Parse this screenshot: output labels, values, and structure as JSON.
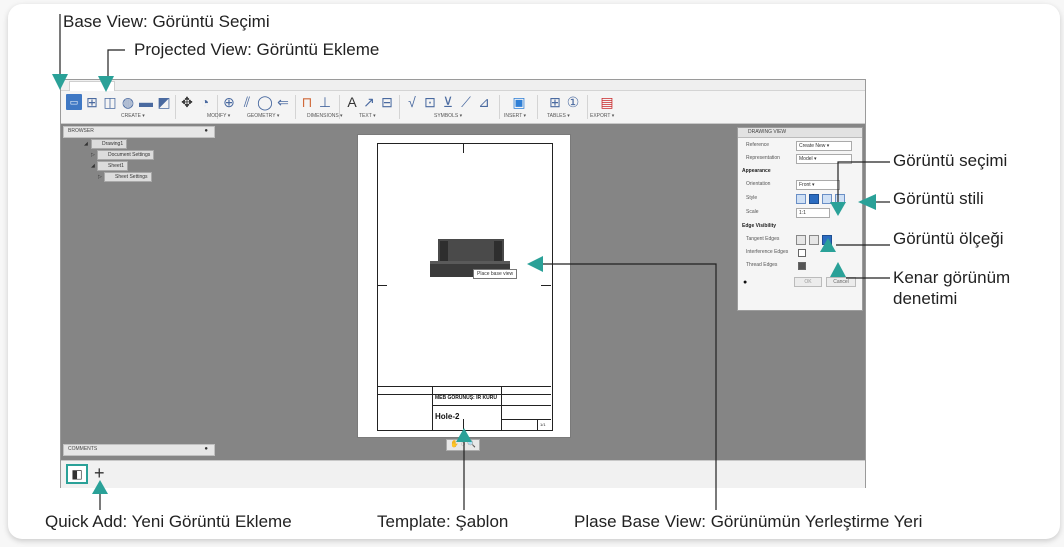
{
  "annotations": {
    "base_view": "Base View: Görüntü Seçimi",
    "projected_view": "Projected View: Görüntü Ekleme",
    "gorunum_secimi": "Görüntü seçimi",
    "gorunum_stili": "Görüntü stili",
    "gorunum_olcegi": "Görüntü ölçeği",
    "kenar_line1": "Kenar görünüm",
    "kenar_line2": "denetimi",
    "quick_add": "Quick Add: Yeni Görüntü Ekleme",
    "template": "Template: Şablon",
    "place_base_view": "Plase Base View: Görünümün Yerleştirme Yeri"
  },
  "toolbar": {
    "groups": [
      "CREATE ▾",
      "MODIFY ▾",
      "GEOMETRY ▾",
      "DIMENSIONS ▾",
      "TEXT ▾",
      "SYMBOLS ▾",
      "INSERT ▾",
      "TABLES ▾",
      "EXPORT ▾"
    ]
  },
  "browser": {
    "title": "BROWSER",
    "items": [
      "Drawing1",
      "Document Settings",
      "Sheet1",
      "Sheet Settings"
    ]
  },
  "comments": {
    "title": "COMMENTS"
  },
  "sheet": {
    "tooltip": "Place base view",
    "title_block_name": "MEB GÖRÜNÜŞ: İR KURU",
    "part_name": "Hole-2",
    "sheet_no": "1/1"
  },
  "dialog": {
    "title": "DRAWING VIEW",
    "reference_label": "Reference",
    "reference_value": "Create New ▾",
    "representation_label": "Representation",
    "representation_value": "Model ▾",
    "appearance_section": "Appearance",
    "orientation_label": "Orientation",
    "orientation_value": "Front ▾",
    "style_label": "Style",
    "scale_label": "Scale",
    "scale_value": "1:1",
    "edge_section": "Edge Visibility",
    "tangent_label": "Tangent Edges",
    "interference_label": "Interference Edges",
    "thread_label": "Thread Edges",
    "ok_label": "OK",
    "cancel_label": "Cancel"
  },
  "colors": {
    "arrow": "#2aa198",
    "canvas": "#858585",
    "accent": "#3f78c4"
  }
}
